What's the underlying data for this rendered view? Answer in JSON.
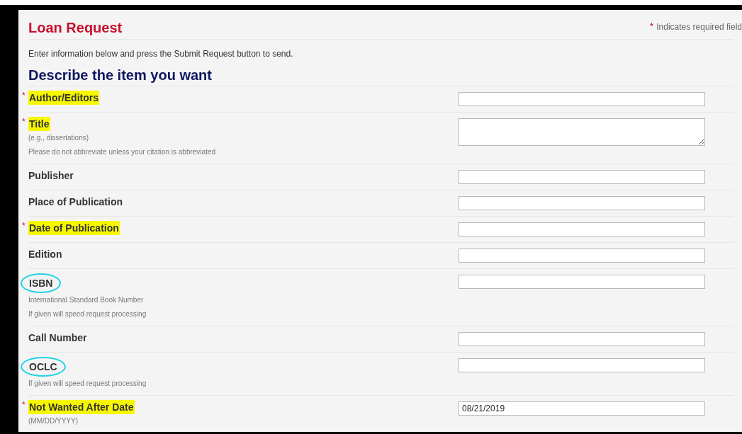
{
  "title": "Loan Request",
  "required_marker": "*",
  "required_note": "Indicates required field",
  "intro": "Enter information below and press the Submit Request button to send.",
  "section_heading": "Describe the item you want",
  "fields": [
    {
      "label": "Author/Editors",
      "required": true,
      "highlighted": true,
      "circled": false,
      "kind": "input"
    },
    {
      "label": "Title",
      "required": true,
      "highlighted": true,
      "circled": false,
      "kind": "textarea",
      "notes": [
        "(e.g., dissertations)",
        "Please do not abbreviate unless your citation is abbreviated"
      ]
    },
    {
      "label": "Publisher",
      "required": false,
      "highlighted": false,
      "circled": false,
      "kind": "input"
    },
    {
      "label": "Place of Publication",
      "required": false,
      "highlighted": false,
      "circled": false,
      "kind": "input"
    },
    {
      "label": "Date of Publication",
      "required": true,
      "highlighted": true,
      "circled": false,
      "kind": "input"
    },
    {
      "label": "Edition",
      "required": false,
      "highlighted": false,
      "circled": false,
      "kind": "input"
    },
    {
      "label": "ISBN",
      "required": false,
      "highlighted": false,
      "circled": true,
      "kind": "input",
      "notes": [
        "International Standard Book Number",
        "If given will speed request processing"
      ]
    },
    {
      "label": "Call Number",
      "required": false,
      "highlighted": false,
      "circled": false,
      "kind": "input"
    },
    {
      "label": "OCLC",
      "required": false,
      "highlighted": false,
      "circled": true,
      "kind": "input",
      "notes": [
        "If given will speed request processing"
      ]
    },
    {
      "label": "Not Wanted After Date",
      "required": true,
      "highlighted": true,
      "circled": false,
      "kind": "input",
      "value": "08/21/2019",
      "notes": [
        "(MM/DD/YYYY)"
      ]
    }
  ]
}
